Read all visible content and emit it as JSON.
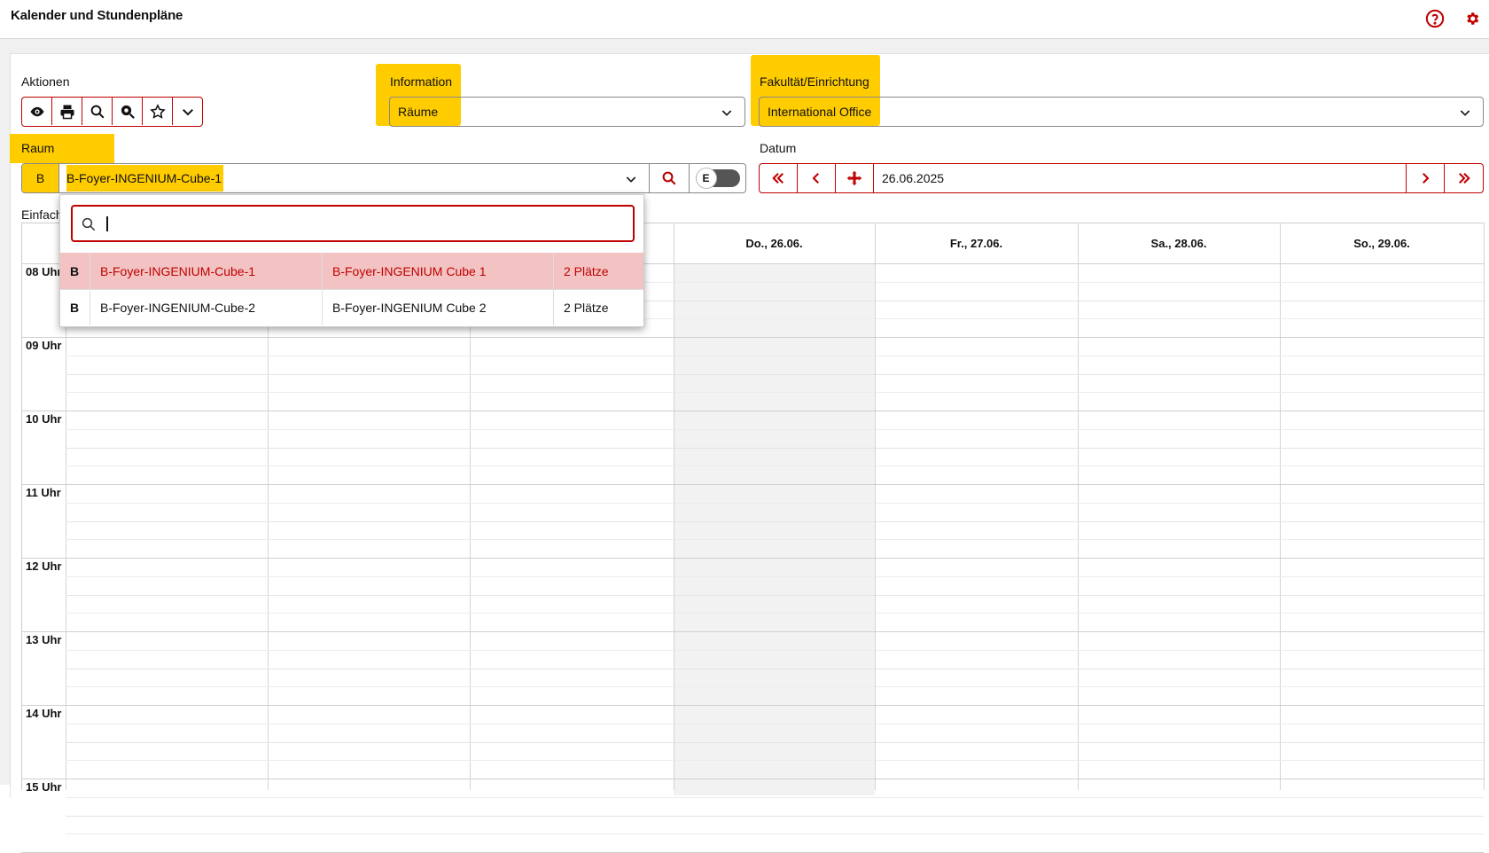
{
  "header": {
    "title": "Kalender und Stundenpläne",
    "help_icon": "help-circle-icon",
    "settings_icon": "gear-icon"
  },
  "actions": {
    "label": "Aktionen",
    "buttons": [
      {
        "icon": "eye-icon",
        "name": "view-button"
      },
      {
        "icon": "printer-icon",
        "name": "print-button"
      },
      {
        "icon": "search-icon",
        "name": "search-button"
      },
      {
        "icon": "zoom-search-icon",
        "name": "advanced-search-button"
      },
      {
        "icon": "star-icon",
        "name": "favorite-button"
      },
      {
        "icon": "chevron-down-icon",
        "name": "more-button"
      }
    ]
  },
  "information": {
    "label": "Information",
    "value": "Räume"
  },
  "faculty": {
    "label": "Fakultät/Einrichtung",
    "value": "International Office"
  },
  "room": {
    "label": "Raum",
    "prefix": "B",
    "value": "B-Foyer-INGENIUM-Cube-1",
    "toggle_label": "E"
  },
  "date": {
    "label": "Datum",
    "value": "26.06.2025"
  },
  "view_label": "Einfach",
  "calendar": {
    "days": [
      "Do., 26.06.",
      "Fr., 27.06.",
      "Sa., 28.06.",
      "So., 29.06."
    ],
    "hours": [
      "08 Uhr",
      "09 Uhr",
      "10 Uhr",
      "11 Uhr",
      "12 Uhr",
      "13 Uhr",
      "14 Uhr",
      "15 Uhr"
    ]
  },
  "dropdown": {
    "search_value": "",
    "rows": [
      {
        "prefix": "B",
        "code": "B-Foyer-INGENIUM-Cube-1",
        "name": "B-Foyer-INGENIUM Cube 1",
        "capacity": "2 Plätze",
        "selected": true
      },
      {
        "prefix": "B",
        "code": "B-Foyer-INGENIUM-Cube-2",
        "name": "B-Foyer-INGENIUM Cube 2",
        "capacity": "2 Plätze",
        "selected": false
      }
    ]
  },
  "colors": {
    "accent": "#c00000",
    "highlight": "#ffcc00",
    "selected_row": "#f3c3c3"
  }
}
